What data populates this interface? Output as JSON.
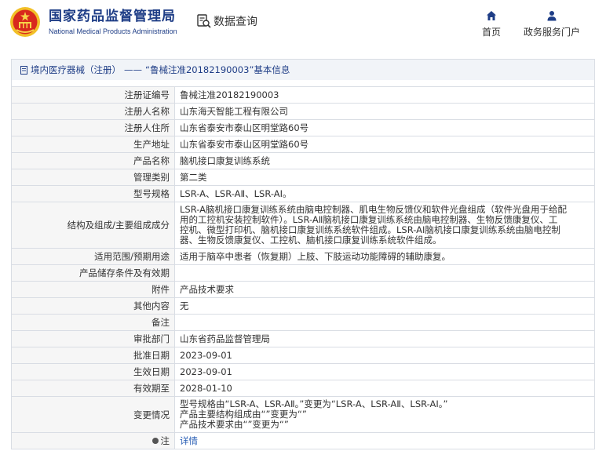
{
  "header": {
    "logo_cn": "国家药品监督管理局",
    "logo_en": "National Medical Products Administration",
    "query_label": "数据查询",
    "nav": [
      {
        "label": "首页",
        "icon": "home-icon"
      },
      {
        "label": "政务服务门户",
        "icon": "user-icon"
      }
    ]
  },
  "breadcrumb": {
    "category": "境内医疗器械（注册）",
    "separator": "——",
    "title": "“鲁械注准20182190003”基本信息"
  },
  "details": {
    "reg_no": {
      "label": "注册证编号",
      "value": "鲁械注准20182190003"
    },
    "registrant": {
      "label": "注册人名称",
      "value": "山东海天智能工程有限公司"
    },
    "registrant_addr": {
      "label": "注册人住所",
      "value": "山东省泰安市泰山区明堂路60号"
    },
    "production_addr": {
      "label": "生产地址",
      "value": "山东省泰安市泰山区明堂路60号"
    },
    "product_name": {
      "label": "产品名称",
      "value": "脑机接口康复训练系统"
    },
    "mgmt_class": {
      "label": "管理类别",
      "value": "第二类"
    },
    "model_spec": {
      "label": "型号规格",
      "value": "LSR-A、LSR-AⅡ、LSR-AⅠ。"
    },
    "structure": {
      "label": "结构及组成/主要组成成分",
      "lines": [
        "LSR-A脑机接口康复训练系统由脑电控制器、肌电生物反馈仪和软件光盘组成（软件光盘用于给配",
        "用的工控机安装控制软件）。LSR-AⅡ脑机接口康复训练系统由脑电控制器、生物反馈康复仪、工",
        "控机、微型打印机、脑机接口康复训练系统软件组成。LSR-AⅠ脑机接口康复训练系统由脑电控制",
        "器、生物反馈康复仪、工控机、脑机接口康复训练系统软件组成。"
      ]
    },
    "scope": {
      "label": "适用范围/预期用途",
      "value": "适用于脑卒中患者（恢复期）上肢、下肢运动功能障碍的辅助康复。"
    },
    "storage": {
      "label": "产品储存条件及有效期",
      "value": ""
    },
    "attachment": {
      "label": "附件",
      "value": "产品技术要求"
    },
    "other": {
      "label": "其他内容",
      "value": "无"
    },
    "remark": {
      "label": "备注",
      "value": ""
    },
    "approval_dept": {
      "label": "审批部门",
      "value": "山东省药品监督管理局"
    },
    "approval_date": {
      "label": "批准日期",
      "value": "2023-09-01"
    },
    "effective_date": {
      "label": "生效日期",
      "value": "2023-09-01"
    },
    "expiry_date": {
      "label": "有效期至",
      "value": "2028-01-10"
    },
    "changes": {
      "label": "变更情况",
      "lines": [
        "型号规格由“LSR-A、LSR-AⅡ。”变更为“LSR-A、LSR-AⅡ、LSR-AⅠ。”",
        "产品主要结构组成由“”变更为“”",
        "产品技术要求由“”变更为“”"
      ]
    },
    "note": {
      "label": "注",
      "value": "详情"
    }
  }
}
